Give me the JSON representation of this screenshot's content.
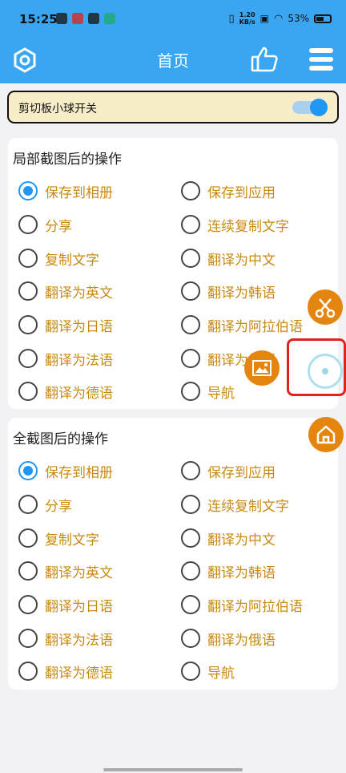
{
  "status_bar": {
    "time": "15:25",
    "net_speed_value": "1.20",
    "net_speed_unit": "KB/s",
    "battery": "53%"
  },
  "header": {
    "title": "首页",
    "settings_icon": "hexagon-settings-icon",
    "like_icon": "thumbs-up-icon",
    "menu_icon": "hamburger-menu-icon"
  },
  "clipboard_switch": {
    "label": "剪切板小球开关",
    "enabled": true
  },
  "partial_section": {
    "title": "局部截图后的操作",
    "options": [
      {
        "label": "保存到相册",
        "selected": true
      },
      {
        "label": "保存到应用",
        "selected": false
      },
      {
        "label": "分享",
        "selected": false
      },
      {
        "label": "连续复制文字",
        "selected": false
      },
      {
        "label": "复制文字",
        "selected": false
      },
      {
        "label": "翻译为中文",
        "selected": false
      },
      {
        "label": "翻译为英文",
        "selected": false
      },
      {
        "label": "翻译为韩语",
        "selected": false
      },
      {
        "label": "翻译为日语",
        "selected": false
      },
      {
        "label": "翻译为阿拉伯语",
        "selected": false
      },
      {
        "label": "翻译为法语",
        "selected": false
      },
      {
        "label": "翻译为俄语",
        "selected": false
      },
      {
        "label": "翻译为德语",
        "selected": false
      },
      {
        "label": "导航",
        "selected": false
      }
    ]
  },
  "full_section": {
    "title": "全截图后的操作",
    "options": [
      {
        "label": "保存到相册",
        "selected": true
      },
      {
        "label": "保存到应用",
        "selected": false
      },
      {
        "label": "分享",
        "selected": false
      },
      {
        "label": "连续复制文字",
        "selected": false
      },
      {
        "label": "复制文字",
        "selected": false
      },
      {
        "label": "翻译为中文",
        "selected": false
      },
      {
        "label": "翻译为英文",
        "selected": false
      },
      {
        "label": "翻译为韩语",
        "selected": false
      },
      {
        "label": "翻译为日语",
        "selected": false
      },
      {
        "label": "翻译为阿拉伯语",
        "selected": false
      },
      {
        "label": "翻译为法语",
        "selected": false
      },
      {
        "label": "翻译为俄语",
        "selected": false
      },
      {
        "label": "翻译为德语",
        "selected": false
      },
      {
        "label": "导航",
        "selected": false
      }
    ]
  },
  "floating_buttons": {
    "scissors_icon": "scissors-icon",
    "screenshot_icon": "image-frame-icon",
    "ball_icon": "floating-ball-icon",
    "home_icon": "home-icon",
    "accent_color": "#e3850f",
    "highlight_color": "#e0241c"
  },
  "colors": {
    "header": "#3aa6f2",
    "option_text": "#c88a12",
    "radio_selected": "#2196f3"
  }
}
